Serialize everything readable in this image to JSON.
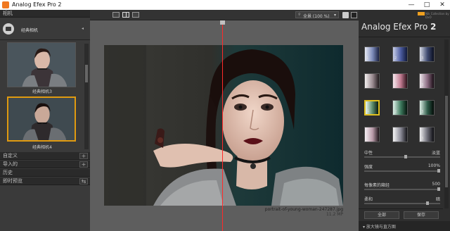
{
  "window": {
    "title": "Analog Efex Pro 2",
    "minimize": "—",
    "maximize": "□",
    "close": "✕"
  },
  "left_panel": {
    "camera_header": "相机",
    "category_label": "经典相机",
    "thumbs": [
      {
        "label": "经典相机3",
        "selected": false
      },
      {
        "label": "经典相机4",
        "selected": true
      }
    ],
    "sections": [
      {
        "label": "自定义",
        "action": "+"
      },
      {
        "label": "导入的",
        "action": "+"
      },
      {
        "label": "历史",
        "action": ""
      },
      {
        "label": "即时预览",
        "action": ""
      }
    ]
  },
  "toolbar": {
    "zoom_label": "全景 (100 %)",
    "zoom_arrow": "▾"
  },
  "canvas": {
    "file_name": "portrait-of-young-woman-247287.jpg",
    "file_size": "11.2 MP"
  },
  "right_panel": {
    "brand_small": "Nik Collection by DxO",
    "app_name": "Analog Efex Pro",
    "version": "2",
    "presets": [
      {
        "num": "1",
        "colors": [
          "#e8eaf5",
          "#7b8ab8",
          "#1a2040"
        ]
      },
      {
        "num": "2",
        "colors": [
          "#c8cee8",
          "#4c5ca0",
          "#101838"
        ]
      },
      {
        "num": "3",
        "colors": [
          "#d8dce8",
          "#3e4a70",
          "#0a0e20"
        ]
      },
      {
        "num": "1",
        "colors": [
          "#f4f0f0",
          "#9a8a90",
          "#201a1c"
        ]
      },
      {
        "num": "2",
        "colors": [
          "#f8e8ee",
          "#c07a90",
          "#2a1018"
        ]
      },
      {
        "num": "3",
        "colors": [
          "#f0e8ee",
          "#8a6a80",
          "#180c14"
        ]
      },
      {
        "num": "1",
        "colors": [
          "#eaf6ee",
          "#5a8a6a",
          "#081a10"
        ],
        "selected": true
      },
      {
        "num": "2",
        "colors": [
          "#e0f2ea",
          "#3e7a5e",
          "#04140c"
        ]
      },
      {
        "num": "3",
        "colors": [
          "#dcefe6",
          "#2e5a48",
          "#020a06"
        ]
      },
      {
        "num": "1",
        "colors": [
          "#f6f0f4",
          "#b89aa8",
          "#1c1418"
        ]
      },
      {
        "num": "2",
        "colors": [
          "#f6f6f6",
          "#8a8a96",
          "#141418"
        ]
      },
      {
        "num": "3",
        "colors": [
          "#f0f0f2",
          "#6a6a74",
          "#0c0c10"
        ]
      }
    ],
    "sliders": [
      {
        "label": "中性",
        "value_right": "淡蓝",
        "pct": 55
      },
      {
        "label": "强度",
        "value_right": "100%",
        "pct": 100
      },
      {
        "label": "每像素的箱轻",
        "value_right": "500",
        "pct": 100
      },
      {
        "label": "柔和",
        "value_right": "暗",
        "pct": 85
      }
    ],
    "buttons": {
      "all": "全部",
      "save": "保存"
    },
    "footer": "▾ 放大镜与直方图"
  }
}
